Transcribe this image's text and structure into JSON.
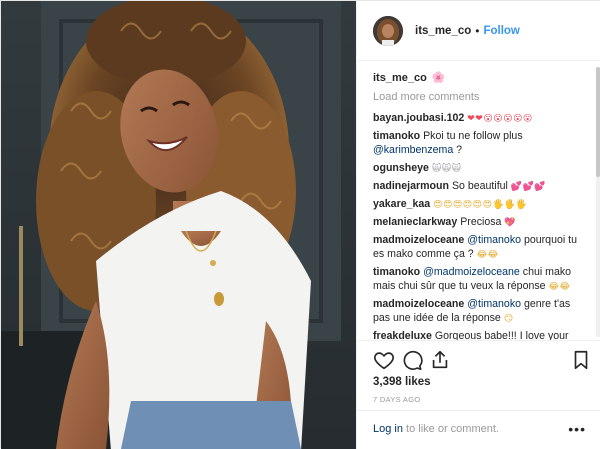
{
  "post": {
    "username": "its_me_co",
    "follow_label": "Follow",
    "dot": "•"
  },
  "caption": {
    "username": "its_me_co",
    "emoji": "🌸"
  },
  "load_more_label": "Load more comments",
  "comments": [
    {
      "user": "bayan.joubasi.102",
      "text": "",
      "emoji": "❤❤😮😮😮😮😮"
    },
    {
      "user": "timanoko",
      "text": "Pkoi tu ne follow plus",
      "mention": "@karimbenzema",
      "after": " ?"
    },
    {
      "user": "ogunsheye",
      "emoji": "🙀🙀🙀"
    },
    {
      "user": "nadinejarmoun",
      "text": "So beautiful",
      "emoji": "💕💕💕"
    },
    {
      "user": "yakare_kaa",
      "emoji": "😍😍😍😍😍😍🖐🖐🖐"
    },
    {
      "user": "melanieclarkway",
      "text": "Preciosa",
      "emoji": "💖"
    },
    {
      "user": "madmoizeloceane",
      "mention": "@timanoko",
      "text": "pourquoi tu es mako comme ça ?",
      "emoji": "😂😂"
    },
    {
      "user": "timanoko",
      "mention": "@madmoizeloceane",
      "text": "chui mako mais chui sûr que tu veux la réponse",
      "emoji": "😂😂"
    },
    {
      "user": "madmoizeloceane",
      "mention": "@timanoko",
      "text": "genre t'as pas une idée de la réponse",
      "emoji": "😏"
    },
    {
      "user": "freakdeluxe",
      "text": "Gorgeous babe!!! I love your"
    }
  ],
  "likes": "3,398 likes",
  "date": "7 DAYS AGO",
  "footer": {
    "login_link": "Log in",
    "login_rest": " to like or comment.",
    "more": "•••"
  },
  "icons": [
    "heart-icon",
    "comment-icon",
    "share-icon",
    "bookmark-icon",
    "more-options-icon"
  ],
  "colors": {
    "link": "#3897f0",
    "mention": "#003569",
    "meta": "#999999",
    "heart": "#ed4956"
  }
}
